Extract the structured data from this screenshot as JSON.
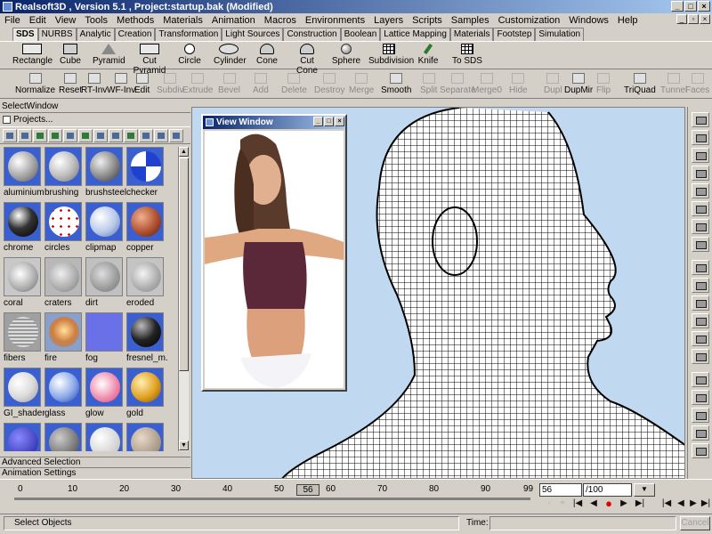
{
  "app": {
    "title": "Realsoft3D , Version 5.1 , Project:startup.bak (Modified)"
  },
  "menu": [
    "File",
    "Edit",
    "View",
    "Tools",
    "Methods",
    "Materials",
    "Animation",
    "Macros",
    "Environments",
    "Layers",
    "Scripts",
    "Samples",
    "Customization",
    "Windows",
    "Help"
  ],
  "tabs": [
    "SDS",
    "NURBS",
    "Analytic",
    "Creation",
    "Transformation",
    "Light Sources",
    "Construction",
    "Boolean",
    "Lattice Mapping",
    "Materials",
    "Footstep",
    "Simulation"
  ],
  "tools_row1": [
    "Rectangle",
    "Cube",
    "Pyramid",
    "Cut Pyramid",
    "Circle",
    "Cylinder",
    "Cone",
    "Cut Cone",
    "Sphere",
    "Subdivision",
    "Knife",
    "To SDS"
  ],
  "tools_row2": [
    {
      "label": "Normalize",
      "enabled": true
    },
    {
      "label": "Reset",
      "enabled": true
    },
    {
      "label": "RT-Inv",
      "enabled": true
    },
    {
      "label": "WF-Inv",
      "enabled": true
    },
    {
      "label": "Edit",
      "enabled": true
    },
    {
      "label": "Subdiv",
      "enabled": false
    },
    {
      "label": "Extrude",
      "enabled": false
    },
    {
      "label": "Bevel",
      "enabled": false
    },
    {
      "label": "Add",
      "enabled": false
    },
    {
      "label": "Delete",
      "enabled": false
    },
    {
      "label": "Destroy",
      "enabled": false
    },
    {
      "label": "Merge",
      "enabled": false
    },
    {
      "label": "Smooth",
      "enabled": true
    },
    {
      "label": "Split",
      "enabled": false
    },
    {
      "label": "Separate",
      "enabled": false
    },
    {
      "label": "Merge0",
      "enabled": false
    },
    {
      "label": "Hide",
      "enabled": false
    },
    {
      "label": "Dupl",
      "enabled": false
    },
    {
      "label": "DupMir",
      "enabled": true
    },
    {
      "label": "Flip",
      "enabled": false
    },
    {
      "label": "TriQuad",
      "enabled": true
    },
    {
      "label": "Tunnel",
      "enabled": false
    },
    {
      "label": "Faces",
      "enabled": false
    }
  ],
  "select_window": {
    "title": "SelectWindow",
    "projects_label": "Projects...",
    "materials": [
      "aluminium",
      "brushing",
      "brushsteel",
      "checker",
      "chrome",
      "circles",
      "clipmap",
      "copper",
      "coral",
      "craters",
      "dirt",
      "eroded",
      "fibers",
      "fire",
      "fog",
      "fresnel_m...",
      "GI_shader",
      "glass",
      "glow",
      "gold"
    ],
    "advanced_selection": "Advanced Selection",
    "animation_settings": "Animation Settings"
  },
  "view_window": {
    "title": "View Window"
  },
  "timeline": {
    "ticks": [
      "0",
      "10",
      "20",
      "30",
      "40",
      "50",
      "60",
      "70",
      "80",
      "90",
      "99"
    ],
    "current_frame": "56",
    "frame_input": "56",
    "frame_total": "/100"
  },
  "status": {
    "text": "Select Objects",
    "time_label": "Time:",
    "cancel": "Cancel"
  },
  "colors": {
    "viewport_bg": "#c0d8f0",
    "titlebar": "#0a246a",
    "record": "#e00000"
  }
}
